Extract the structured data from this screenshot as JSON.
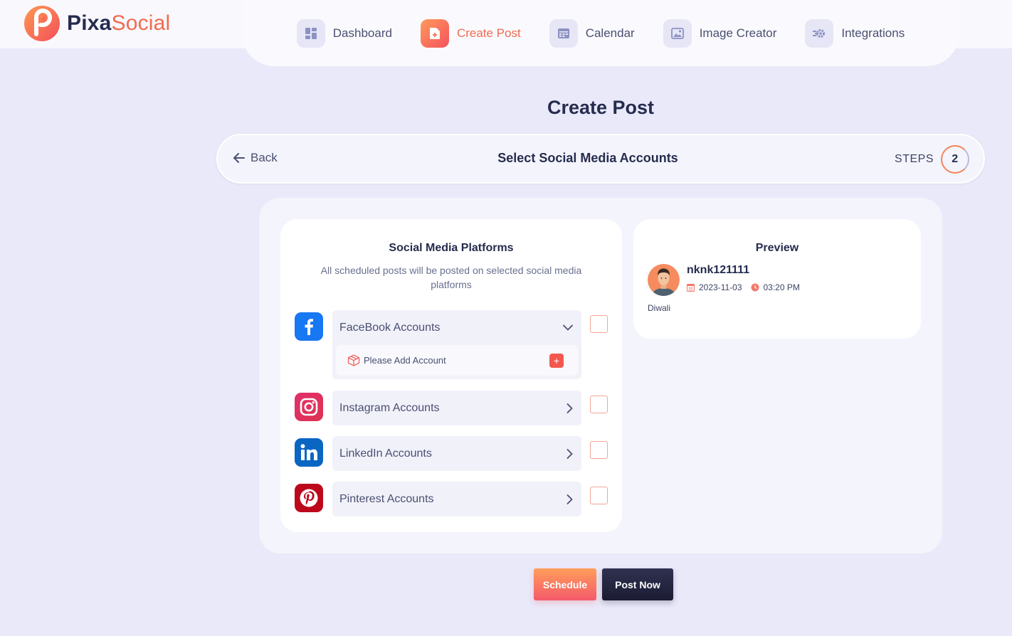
{
  "brand": {
    "name_a": "Pixa",
    "name_b": "Social"
  },
  "nav": [
    {
      "label": "Dashboard",
      "icon": "dashboard-icon"
    },
    {
      "label": "Create Post",
      "icon": "create-post-icon",
      "active": true
    },
    {
      "label": "Calendar",
      "icon": "calendar-icon"
    },
    {
      "label": "Image Creator",
      "icon": "image-icon"
    },
    {
      "label": "Integrations",
      "icon": "integrations-icon"
    }
  ],
  "page": {
    "title": "Create Post"
  },
  "stepbar": {
    "back_label": "Back",
    "title": "Select Social Media Accounts",
    "steps_label": "STEPS",
    "step_number": "2"
  },
  "platforms": {
    "title": "Social Media Platforms",
    "subtitle": "All scheduled posts will be posted on selected social media platforms",
    "items": [
      {
        "label": "FaceBook Accounts",
        "icon": "facebook-icon",
        "expanded": true,
        "empty_text": "Please Add Account"
      },
      {
        "label": "Instagram Accounts",
        "icon": "instagram-icon",
        "expanded": false
      },
      {
        "label": "LinkedIn Accounts",
        "icon": "linkedin-icon",
        "expanded": false
      },
      {
        "label": "Pinterest Accounts",
        "icon": "pinterest-icon",
        "expanded": false
      }
    ]
  },
  "preview": {
    "title": "Preview",
    "username": "nknk121111",
    "date": "2023-11-03",
    "time": "03:20 PM",
    "caption": "Diwali"
  },
  "actions": {
    "schedule_label": "Schedule",
    "post_now_label": "Post Now"
  },
  "colors": {
    "accent": "#f26a4f",
    "background": "#e9e9fa",
    "dark": "#262c4e",
    "facebook": "#1877f2",
    "instagram": "#e1306c",
    "linkedin": "#0a66c2",
    "pinterest": "#bd081c"
  }
}
